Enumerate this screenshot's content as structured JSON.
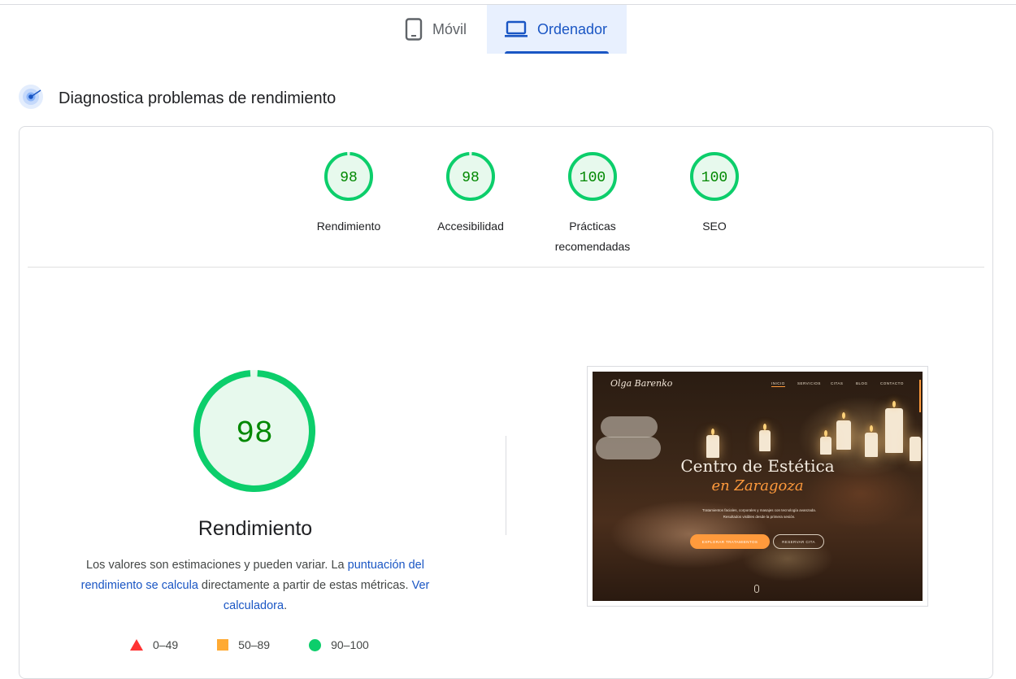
{
  "tabs": [
    {
      "label": "Móvil",
      "icon": "smartphone-icon",
      "selected": false
    },
    {
      "label": "Ordenador",
      "icon": "laptop-icon",
      "selected": true
    }
  ],
  "diagnose": {
    "label": "Diagnostica problemas de rendimiento",
    "icon": "lighthouse-radar-icon"
  },
  "categories": [
    {
      "score": "98",
      "label": "Rendimiento",
      "fraction": 0.98
    },
    {
      "score": "98",
      "label": "Accesibilidad",
      "fraction": 0.98
    },
    {
      "score": "100",
      "label": "Prácticas recomendadas",
      "fraction": 1.0
    },
    {
      "score": "100",
      "label": "SEO",
      "fraction": 1.0
    }
  ],
  "performance": {
    "score": "98",
    "fraction": 0.98,
    "title": "Rendimiento",
    "desc_prefix": "Los valores son estimaciones y pueden variar. La ",
    "desc_link1": "puntuación del rendimiento se calcula",
    "desc_middle": " directamente a partir de estas métricas. ",
    "desc_link2": "Ver calculadora",
    "desc_suffix": "."
  },
  "legend": [
    {
      "range": "0–49",
      "shape": "triangle",
      "color": "#ff3333"
    },
    {
      "range": "50–89",
      "shape": "square",
      "color": "#ffaa33"
    },
    {
      "range": "90–100",
      "shape": "circle",
      "color": "#0cce6b"
    }
  ],
  "colors": {
    "pass": "#0cce6b",
    "pass_text": "#008800",
    "pass_bg": "#e7f9ed",
    "accent": "#1a56c4",
    "selected_tab_bg": "#e8f0fe"
  },
  "screenshot": {
    "logo": "Olga Barenko",
    "nav": [
      "INICIO",
      "SERVICIOS",
      "CITAS",
      "BLOG",
      "CONTACTO"
    ],
    "title": "Centro de Estética",
    "subtitle": "en Zaragoza",
    "text_line1": "Tratamientos faciales, corporales y masajes con tecnología avanzada.",
    "text_line2": "Resultados visibles desde la primera sesión.",
    "btn_primary": "EXPLORAR TRATAMIENTOS",
    "btn_secondary": "RESERVAR CITA"
  }
}
